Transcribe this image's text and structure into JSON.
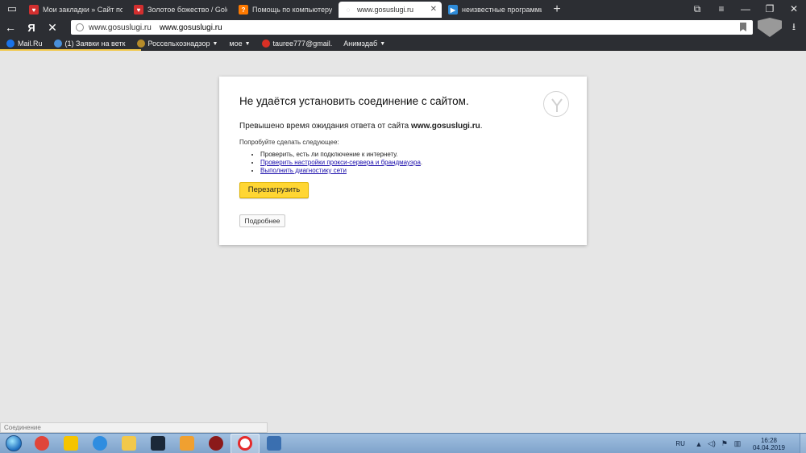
{
  "tabs": [
    {
      "title": "Мои закладки » Сайт по а",
      "favicon": "bookmark-icon",
      "color": "#d32f2f",
      "glyph": "♥"
    },
    {
      "title": "Золотое божество / Golde",
      "favicon": "bookmark-icon",
      "color": "#d32f2f",
      "glyph": "♥"
    },
    {
      "title": "Помощь по компьютеру",
      "favicon": "help-icon",
      "color": "#ff7a00",
      "glyph": "?"
    },
    {
      "title": "www.gosuslugi.ru",
      "favicon": "loading-icon",
      "color": "#cccccc",
      "glyph": "◌",
      "active": true
    },
    {
      "title": "неизвестные программы",
      "favicon": "play-icon",
      "color": "#2e8bd8",
      "glyph": "▶"
    }
  ],
  "toolbar": {
    "yandex_label": "Я",
    "host": "www.gosuslugi.ru",
    "url": "www.gosuslugi.ru"
  },
  "bookmarks": [
    {
      "label": "Mail.Ru",
      "color": "#1a73e8",
      "caret": false
    },
    {
      "label": "(1) Заявки на ветк",
      "color": "#4a90d9",
      "caret": false
    },
    {
      "label": "Россельхознадзор",
      "color": "#b58b2a",
      "caret": true
    },
    {
      "label": "мое",
      "color": "",
      "caret": true
    },
    {
      "label": "tauree777@gmail.",
      "color": "#d93025",
      "caret": false
    },
    {
      "label": "Анимэдаб",
      "color": "",
      "caret": true
    }
  ],
  "error": {
    "title": "Не удаётся установить соединение с сайтом.",
    "timeout_prefix": "Превышено время ожидания ответа от сайта ",
    "timeout_host": "www.gosuslugi.ru",
    "timeout_suffix": ".",
    "try_label": "Попробуйте сделать следующее:",
    "suggestions": [
      {
        "text": "Проверить, есть ли подключение к интернету.",
        "link": false
      },
      {
        "text": "Проверить настройки прокси-сервера и брандмауэра",
        "link": true,
        "suffix": "."
      },
      {
        "text": "Выполнить диагностику сети",
        "link": true,
        "suffix": ""
      }
    ],
    "reload_label": "Перезагрузить",
    "details_label": "Подробнее"
  },
  "status_text": "Соединение",
  "taskbar": {
    "apps": [
      {
        "name": "chrome-icon",
        "color": "#e0453a"
      },
      {
        "name": "norton-icon",
        "color": "#f5c400"
      },
      {
        "name": "internet-explorer-icon",
        "color": "#2f8de0"
      },
      {
        "name": "file-explorer-icon",
        "color": "#f2c84b"
      },
      {
        "name": "steam-icon",
        "color": "#1b2838"
      },
      {
        "name": "media-player-icon",
        "color": "#f0a030"
      },
      {
        "name": "app-icon",
        "color": "#8b1a1a"
      },
      {
        "name": "yandex-browser-icon",
        "color": "#ffffff",
        "active": true
      },
      {
        "name": "shield-app-icon",
        "color": "#3a6fb0"
      }
    ],
    "lang": "RU",
    "time": "16:28",
    "date": "04.04.2019"
  }
}
